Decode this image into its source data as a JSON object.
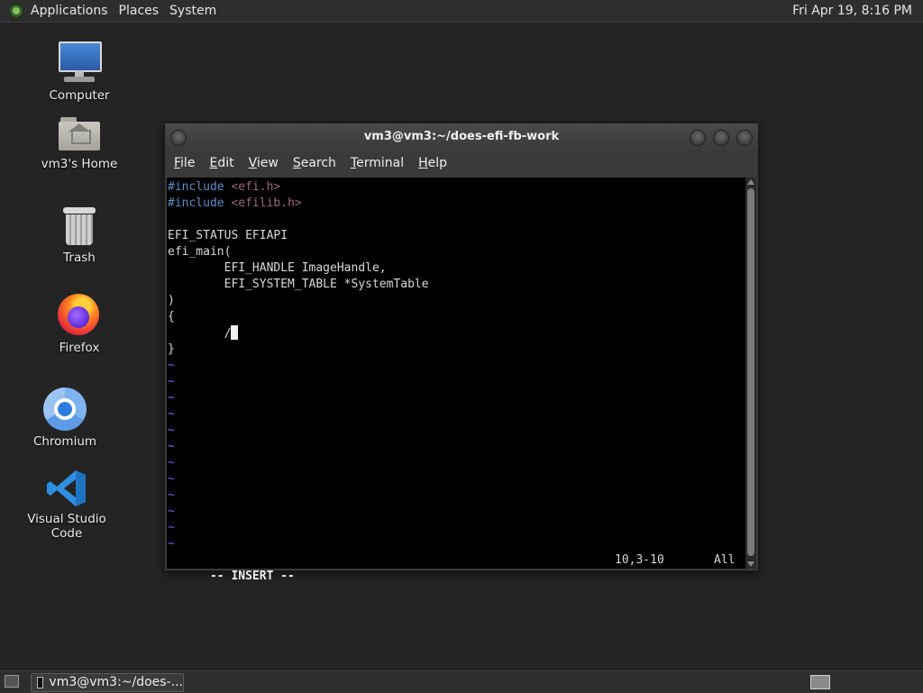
{
  "top_panel": {
    "menus": [
      "Applications",
      "Places",
      "System"
    ],
    "clock": "Fri Apr 19,  8:16 PM"
  },
  "desktop_icons": {
    "computer": "Computer",
    "home": "vm3's Home",
    "trash": "Trash",
    "firefox": "Firefox",
    "chromium": "Chromium",
    "vscode": "Visual Studio Code"
  },
  "window": {
    "title": "vm3@vm3:~/does-efi-fb-work",
    "menu": [
      {
        "mnemonic": "F",
        "rest": "ile"
      },
      {
        "mnemonic": "E",
        "rest": "dit"
      },
      {
        "mnemonic": "V",
        "rest": "iew"
      },
      {
        "mnemonic": "S",
        "rest": "earch"
      },
      {
        "mnemonic": "T",
        "rest": "erminal"
      },
      {
        "mnemonic": "H",
        "rest": "elp"
      }
    ]
  },
  "editor": {
    "lines": {
      "l1_directive": "#include",
      "l1_file": " <efi.h>",
      "l2_directive": "#include",
      "l2_file": " <efilib.h>",
      "l4": "EFI_STATUS EFIAPI",
      "l5": "efi_main(",
      "l6": "        EFI_HANDLE ImageHandle,",
      "l7": "        EFI_SYSTEM_TABLE *SystemTable",
      "l8": ")",
      "l9": "{",
      "l10": "        /",
      "l11": "}"
    },
    "tilde": "~",
    "status": {
      "mode": "-- INSERT --",
      "position": "10,3-10",
      "scroll": "All"
    }
  },
  "taskbar": {
    "task_label": "vm3@vm3:~/does-..."
  }
}
